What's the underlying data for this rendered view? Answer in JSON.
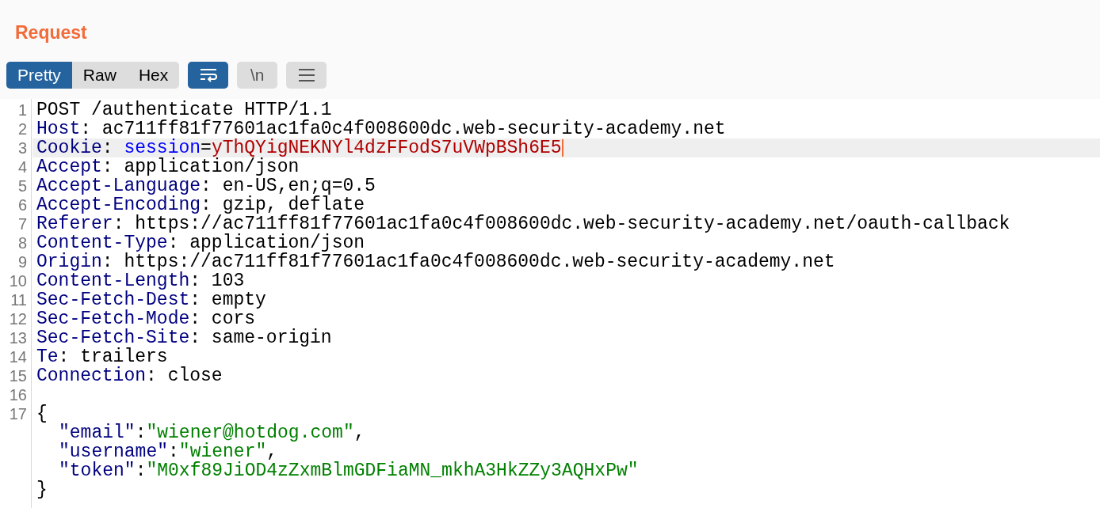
{
  "title": "Request",
  "view_tabs": [
    {
      "label": "Pretty",
      "selected": true
    },
    {
      "label": "Raw",
      "selected": false
    },
    {
      "label": "Hex",
      "selected": false
    }
  ],
  "tool_buttons": [
    {
      "kind": "wrap",
      "selected": true
    },
    {
      "kind": "newline",
      "label": "\\n",
      "selected": false
    },
    {
      "kind": "menu",
      "selected": false
    }
  ],
  "lines": [
    {
      "number": "1",
      "highlighted": false,
      "segments": [
        {
          "kind": "plain",
          "text": "POST /authenticate HTTP/1.1"
        }
      ]
    },
    {
      "number": "2",
      "highlighted": false,
      "segments": [
        {
          "kind": "header",
          "text": "Host"
        },
        {
          "kind": "plain",
          "text": ": ac711ff81f77601ac1fa0c4f008600dc.web-security-academy.net"
        }
      ]
    },
    {
      "number": "3",
      "highlighted": true,
      "cursor": true,
      "segments": [
        {
          "kind": "header",
          "text": "Cookie"
        },
        {
          "kind": "plain",
          "text": ": "
        },
        {
          "kind": "param",
          "text": "session"
        },
        {
          "kind": "plain",
          "text": "="
        },
        {
          "kind": "value",
          "text": "yThQYigNEKNYl4dzFFodS7uVWpBSh6E5"
        }
      ]
    },
    {
      "number": "4",
      "highlighted": false,
      "segments": [
        {
          "kind": "header",
          "text": "Accept"
        },
        {
          "kind": "plain",
          "text": ": application/json"
        }
      ]
    },
    {
      "number": "5",
      "highlighted": false,
      "segments": [
        {
          "kind": "header",
          "text": "Accept-Language"
        },
        {
          "kind": "plain",
          "text": ": en-US,en;q=0.5"
        }
      ]
    },
    {
      "number": "6",
      "highlighted": false,
      "segments": [
        {
          "kind": "header",
          "text": "Accept-Encoding"
        },
        {
          "kind": "plain",
          "text": ": gzip, deflate"
        }
      ]
    },
    {
      "number": "7",
      "highlighted": false,
      "segments": [
        {
          "kind": "header",
          "text": "Referer"
        },
        {
          "kind": "plain",
          "text": ": https://ac711ff81f77601ac1fa0c4f008600dc.web-security-academy.net/oauth-callback"
        }
      ]
    },
    {
      "number": "8",
      "highlighted": false,
      "segments": [
        {
          "kind": "header",
          "text": "Content-Type"
        },
        {
          "kind": "plain",
          "text": ": application/json"
        }
      ]
    },
    {
      "number": "9",
      "highlighted": false,
      "segments": [
        {
          "kind": "header",
          "text": "Origin"
        },
        {
          "kind": "plain",
          "text": ": https://ac711ff81f77601ac1fa0c4f008600dc.web-security-academy.net"
        }
      ]
    },
    {
      "number": "10",
      "highlighted": false,
      "segments": [
        {
          "kind": "header",
          "text": "Content-Length"
        },
        {
          "kind": "plain",
          "text": ": 103"
        }
      ]
    },
    {
      "number": "11",
      "highlighted": false,
      "segments": [
        {
          "kind": "header",
          "text": "Sec-Fetch-Dest"
        },
        {
          "kind": "plain",
          "text": ": empty"
        }
      ]
    },
    {
      "number": "12",
      "highlighted": false,
      "segments": [
        {
          "kind": "header",
          "text": "Sec-Fetch-Mode"
        },
        {
          "kind": "plain",
          "text": ": cors"
        }
      ]
    },
    {
      "number": "13",
      "highlighted": false,
      "segments": [
        {
          "kind": "header",
          "text": "Sec-Fetch-Site"
        },
        {
          "kind": "plain",
          "text": ": same-origin"
        }
      ]
    },
    {
      "number": "14",
      "highlighted": false,
      "segments": [
        {
          "kind": "header",
          "text": "Te"
        },
        {
          "kind": "plain",
          "text": ": trailers"
        }
      ]
    },
    {
      "number": "15",
      "highlighted": false,
      "segments": [
        {
          "kind": "header",
          "text": "Connection"
        },
        {
          "kind": "plain",
          "text": ": close"
        }
      ]
    },
    {
      "number": "16",
      "highlighted": false
    },
    {
      "number": "17",
      "highlighted": false,
      "segments": [
        {
          "kind": "plain",
          "text": "{"
        }
      ],
      "children": [
        {
          "highlighted": false,
          "segments": [
            {
              "kind": "key",
              "text": "\"email\""
            },
            {
              "kind": "plain",
              "text": ":"
            },
            {
              "kind": "string",
              "text": "\"wiener@hotdog.com\""
            },
            {
              "kind": "plain",
              "text": ","
            }
          ]
        },
        {
          "highlighted": false,
          "segments": [
            {
              "kind": "key",
              "text": "\"username\""
            },
            {
              "kind": "plain",
              "text": ":"
            },
            {
              "kind": "string",
              "text": "\"wiener\""
            },
            {
              "kind": "plain",
              "text": ","
            }
          ]
        },
        {
          "highlighted": false,
          "segments": [
            {
              "kind": "key",
              "text": "\"token\""
            },
            {
              "kind": "plain",
              "text": ":"
            },
            {
              "kind": "string",
              "text": "\"M0xf89JiOD4zZxmBlmGDFiaMN_mkhA3HkZZy3AQHxPw\""
            }
          ]
        }
      ]
    },
    {
      "highlighted": false,
      "segments": [
        {
          "kind": "plain",
          "text": "}"
        }
      ]
    }
  ]
}
